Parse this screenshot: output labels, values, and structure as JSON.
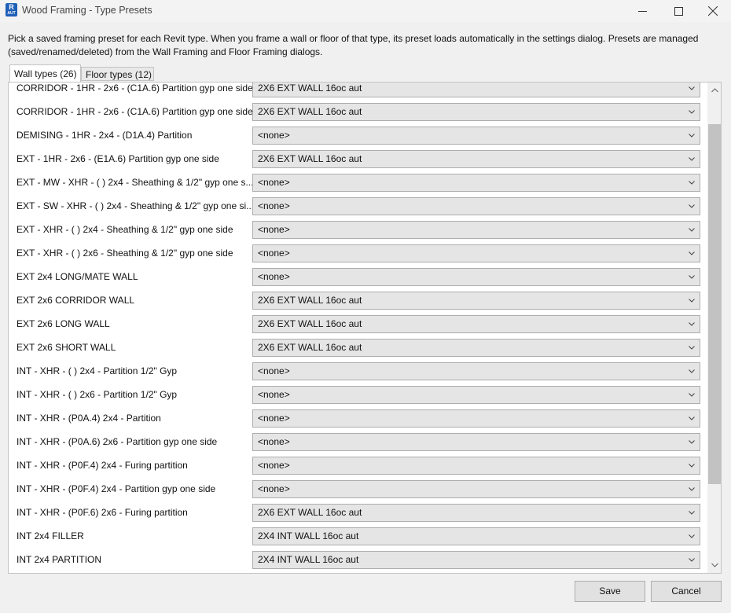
{
  "window": {
    "title": "Wood Framing - Type Presets",
    "app_icon_letter": "R",
    "app_icon_sub": "AUT"
  },
  "description": "Pick a saved framing preset for each Revit type. When you frame a wall or floor of that type, its preset loads automatically in the settings dialog. Presets are managed (saved/renamed/deleted) from the Wall Framing and Floor Framing dialogs.",
  "tabs": [
    {
      "label": "Wall types (26)",
      "active": true
    },
    {
      "label": "Floor types (12)",
      "active": false
    }
  ],
  "rows": [
    {
      "label": "CORRIDOR - 1HR - 2x6 - (C1A.6) Partition gyp one side",
      "value": "2X6 EXT WALL 16oc aut"
    },
    {
      "label": "CORRIDOR - 1HR - 2x6 - (C1A.6) Partition gyp one side...",
      "value": "2X6 EXT WALL 16oc aut"
    },
    {
      "label": "DEMISING - 1HR - 2x4 - (D1A.4) Partition",
      "value": "<none>"
    },
    {
      "label": "EXT - 1HR - 2x6 - (E1A.6) Partition gyp one side",
      "value": "2X6 EXT WALL 16oc aut"
    },
    {
      "label": "EXT - MW - XHR - ( ) 2x4 - Sheathing & 1/2\" gyp one s...",
      "value": "<none>"
    },
    {
      "label": "EXT - SW - XHR - ( ) 2x4 - Sheathing & 1/2\" gyp one si...",
      "value": "<none>"
    },
    {
      "label": "EXT - XHR - ( ) 2x4 - Sheathing & 1/2\" gyp one side",
      "value": "<none>"
    },
    {
      "label": "EXT - XHR - ( ) 2x6 - Sheathing & 1/2\" gyp one side",
      "value": "<none>"
    },
    {
      "label": "EXT 2x4 LONG/MATE WALL",
      "value": "<none>"
    },
    {
      "label": "EXT 2x6 CORRIDOR WALL",
      "value": "2X6 EXT WALL 16oc aut"
    },
    {
      "label": "EXT 2x6 LONG WALL",
      "value": "2X6 EXT WALL 16oc aut"
    },
    {
      "label": "EXT 2x6 SHORT WALL",
      "value": "2X6 EXT WALL 16oc aut"
    },
    {
      "label": "INT - XHR - ( ) 2x4 - Partition 1/2\" Gyp",
      "value": "<none>"
    },
    {
      "label": "INT - XHR - ( ) 2x6 - Partition 1/2\" Gyp",
      "value": "<none>"
    },
    {
      "label": "INT - XHR - (P0A.4) 2x4 - Partition",
      "value": "<none>"
    },
    {
      "label": "INT - XHR - (P0A.6) 2x6 - Partition gyp one side",
      "value": "<none>"
    },
    {
      "label": "INT - XHR - (P0F.4) 2x4 - Furing partition",
      "value": "<none>"
    },
    {
      "label": "INT - XHR - (P0F.4) 2x4 - Partition gyp one side",
      "value": "<none>"
    },
    {
      "label": "INT - XHR - (P0F.6) 2x6 - Furing partition",
      "value": "2X6 EXT WALL 16oc aut"
    },
    {
      "label": "INT 2x4 FILLER",
      "value": "2X4 INT WALL 16oc aut"
    },
    {
      "label": "INT 2x4 PARTITION",
      "value": "2X4 INT WALL 16oc aut"
    }
  ],
  "buttons": {
    "save": "Save",
    "cancel": "Cancel"
  }
}
